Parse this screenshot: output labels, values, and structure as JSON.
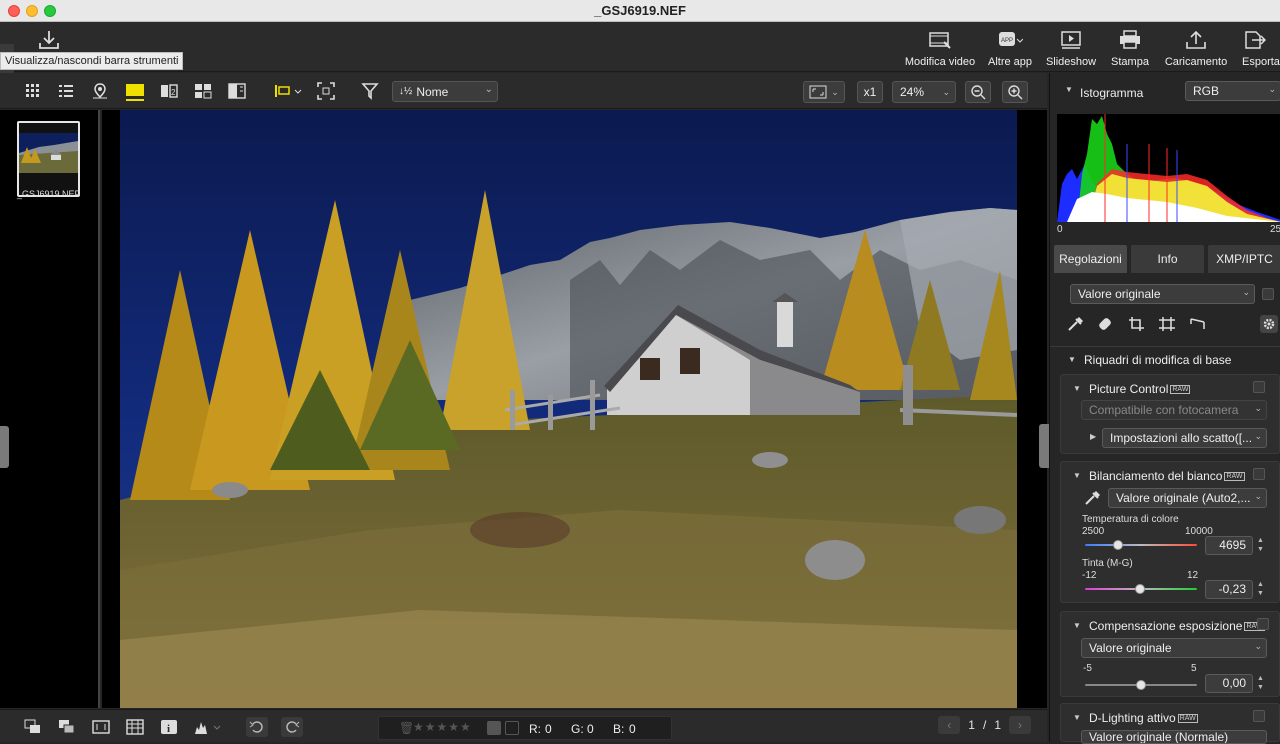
{
  "window": {
    "title": "_GSJ6919.NEF"
  },
  "tooltip": "Visualizza/nascondi barra strumenti",
  "top_toolbar": {
    "items": [
      {
        "label": "Modifica video",
        "icon": "film-edit-icon"
      },
      {
        "label": "Altre app",
        "icon": "app-icon"
      },
      {
        "label": "Slideshow",
        "icon": "slideshow-icon"
      },
      {
        "label": "Stampa",
        "icon": "printer-icon"
      },
      {
        "label": "Caricamento",
        "icon": "upload-icon"
      },
      {
        "label": "Esporta",
        "icon": "export-icon"
      }
    ]
  },
  "view_toolbar": {
    "sort_label": "Nome",
    "zoom_mult": "x1",
    "zoom_percent": "24%"
  },
  "filmstrip": {
    "items": [
      {
        "filename": "_GSJ6919.NEF"
      }
    ]
  },
  "bottom_bar": {
    "r_label": "R:",
    "r_value": "0",
    "g_label": "G:",
    "g_value": "0",
    "b_label": "B:",
    "b_value": "0",
    "page_current": "1",
    "page_sep": "/",
    "page_total": "1"
  },
  "histogram": {
    "title": "Istogramma",
    "channel": "RGB",
    "min_label": "0",
    "max_label": "25"
  },
  "panel_tabs": [
    "Regolazioni",
    "Info",
    "XMP/IPTC"
  ],
  "adjust": {
    "preset": "Valore originale",
    "section_title": "Riquadri di modifica di base",
    "picture_control": {
      "title": "Picture Control",
      "raw_badge": "RAW",
      "compat": "Compatibile con fotocamera",
      "setting": "Impostazioni allo scatto([..."
    },
    "white_balance": {
      "title": "Bilanciamento del bianco",
      "raw_badge": "RAW",
      "value": "Valore originale (Auto2,...",
      "temp_label": "Temperatura di colore",
      "temp_min": "2500",
      "temp_max": "10000",
      "temp_value": "4695",
      "temp_pos": 0.295,
      "tint_label": "Tinta (M-G)",
      "tint_min": "-12",
      "tint_max": "12",
      "tint_value": "-0,23",
      "tint_pos": 0.49
    },
    "exposure": {
      "title": "Compensazione esposizione",
      "raw_badge": "RAW",
      "value": "Valore originale",
      "min": "-5",
      "max": "5",
      "amount": "0,00",
      "pos": 0.5
    },
    "d_lighting": {
      "title": "D-Lighting attivo",
      "raw_badge": "RAW",
      "value": "Valore originale (Normale)"
    }
  },
  "colors": {
    "accent_yellow": "#f0e000",
    "panel_bg": "#262626"
  }
}
